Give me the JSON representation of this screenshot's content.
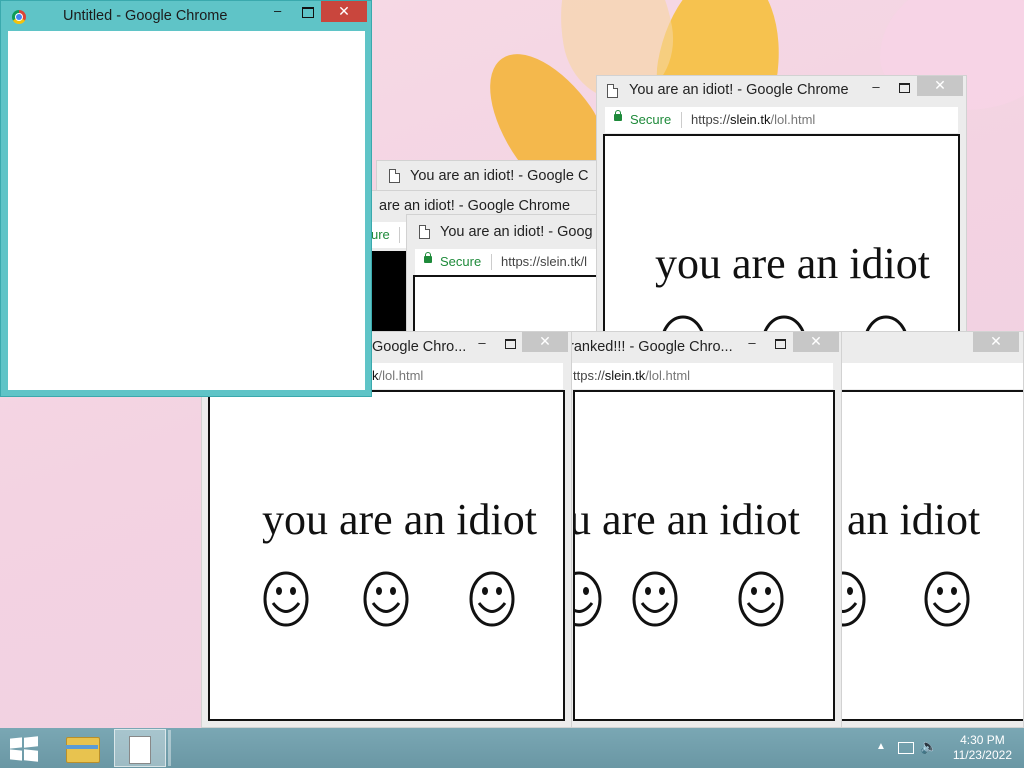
{
  "colors": {
    "secure_green": "#1e8a3a",
    "accent_teal": "#5fc4c7",
    "close_red": "#c9463d"
  },
  "untitled_window": {
    "title": "Untitled - Google Chrome"
  },
  "popup_title": "You are an idiot! - Google Chrome",
  "popup_title_partial_a": "You are an idiot! - Google C",
  "popup_title_partial_b": "are an idiot! - Google Chrome",
  "popup_title_partial_c": "You are an idiot! - Goog",
  "popup_title_partial_d": "Google Chro...",
  "popup_title_partial_e": "ranked!!! - Google Chro...",
  "secure_label": "Secure",
  "secure_label_partial": "ure",
  "url_scheme": "https://",
  "url_host": "slein.tk",
  "url_path": "/lol.html",
  "url_partial_host": "https://slein.tk/l",
  "url_partial_left": "k",
  "url_partial_scheme": "ttps://",
  "popup_message": "you are an idiot",
  "popup_message_partial_a": "u are an idiot",
  "popup_message_partial_b": "an idiot",
  "minimize_glyph": "–",
  "close_glyph": "✕",
  "taskbar": {
    "time": "4:30 PM",
    "date": "11/23/2022",
    "items": [
      "start-icon",
      "file-explorer-icon",
      "document-icon"
    ]
  }
}
